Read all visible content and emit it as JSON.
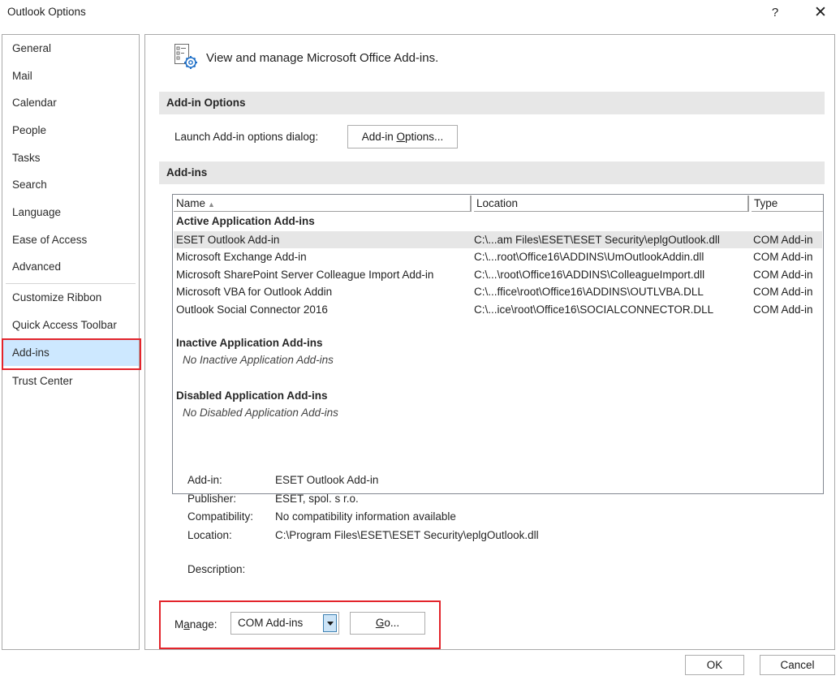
{
  "window": {
    "title": "Outlook Options",
    "help_label": "?",
    "close_label": "✕"
  },
  "nav": {
    "items": [
      {
        "label": "General"
      },
      {
        "label": "Mail"
      },
      {
        "label": "Calendar"
      },
      {
        "label": "People"
      },
      {
        "label": "Tasks"
      },
      {
        "label": "Search"
      },
      {
        "label": "Language"
      },
      {
        "label": "Ease of Access"
      },
      {
        "label": "Advanced"
      },
      {
        "label": "Customize Ribbon"
      },
      {
        "label": "Quick Access Toolbar"
      },
      {
        "label": "Add-ins"
      },
      {
        "label": "Trust Center"
      }
    ],
    "selected": "Add-ins"
  },
  "header": {
    "text": "View and manage Microsoft Office Add-ins.",
    "icon": "addin-settings-icon"
  },
  "addin_options_section": {
    "title": "Add-in Options",
    "launch_label": "Launch Add-in options dialog:",
    "button_label_pre": "Add-in ",
    "button_label_accel": "O",
    "button_label_post": "ptions..."
  },
  "addins_section": {
    "title": "Add-ins",
    "columns": {
      "name": "Name",
      "sort_indicator": "▲",
      "location": "Location",
      "type": "Type"
    },
    "active_group_title": "Active Application Add-ins",
    "active_rows": [
      {
        "name": "ESET Outlook Add-in",
        "location": "C:\\...am Files\\ESET\\ESET Security\\eplgOutlook.dll",
        "type": "COM Add-in"
      },
      {
        "name": "Microsoft Exchange Add-in",
        "location": "C:\\...root\\Office16\\ADDINS\\UmOutlookAddin.dll",
        "type": "COM Add-in"
      },
      {
        "name": "Microsoft SharePoint Server Colleague Import Add-in",
        "location": "C:\\...\\root\\Office16\\ADDINS\\ColleagueImport.dll",
        "type": "COM Add-in"
      },
      {
        "name": "Microsoft VBA for Outlook Addin",
        "location": "C:\\...ffice\\root\\Office16\\ADDINS\\OUTLVBA.DLL",
        "type": "COM Add-in"
      },
      {
        "name": "Outlook Social Connector 2016",
        "location": "C:\\...ice\\root\\Office16\\SOCIALCONNECTOR.DLL",
        "type": "COM Add-in"
      }
    ],
    "inactive_group_title": "Inactive Application Add-ins",
    "inactive_empty": "No Inactive Application Add-ins",
    "disabled_group_title": "Disabled Application Add-ins",
    "disabled_empty": "No Disabled Application Add-ins"
  },
  "details": {
    "addin_label": "Add-in:",
    "addin_value": "ESET Outlook Add-in",
    "publisher_label": "Publisher:",
    "publisher_value": "ESET, spol. s r.o.",
    "compatibility_label": "Compatibility:",
    "compatibility_value": "No compatibility information available",
    "location_label": "Location:",
    "location_value": "C:\\Program Files\\ESET\\ESET Security\\eplgOutlook.dll",
    "description_label": "Description:"
  },
  "manage": {
    "label_pre": "M",
    "label_accel": "a",
    "label_post": "nage:",
    "selected_value": "COM Add-ins",
    "go_accel": "G",
    "go_post": "o..."
  },
  "footer": {
    "ok_label": "OK",
    "cancel_label": "Cancel"
  },
  "colors": {
    "highlight_border": "#e3242b",
    "nav_selected_bg": "#cde8ff",
    "section_bar_bg": "#e7e7e7",
    "selected_row_bg": "#e6e6e6"
  }
}
